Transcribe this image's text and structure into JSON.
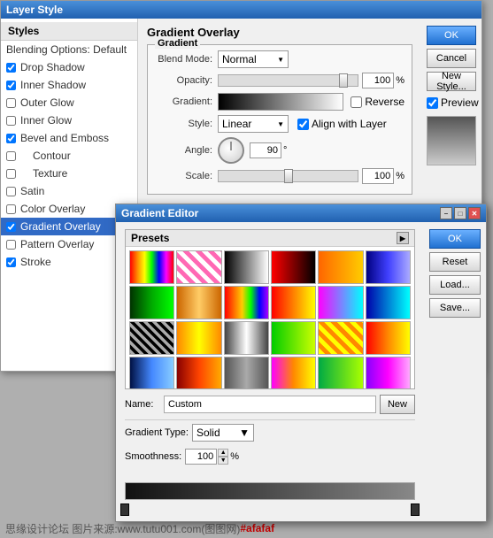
{
  "layerStyleDialog": {
    "title": "Layer Style",
    "buttons": {
      "ok": "OK",
      "cancel": "Cancel",
      "newStyle": "New Style...",
      "preview": "Preview"
    },
    "stylesPanel": {
      "header": "Styles",
      "items": [
        {
          "id": "blending-options",
          "label": "Blending Options: Default",
          "checked": false,
          "active": false
        },
        {
          "id": "drop-shadow",
          "label": "Drop Shadow",
          "checked": true,
          "active": false
        },
        {
          "id": "inner-shadow",
          "label": "Inner Shadow",
          "checked": true,
          "active": false
        },
        {
          "id": "outer-glow",
          "label": "Outer Glow",
          "checked": false,
          "active": false
        },
        {
          "id": "inner-glow",
          "label": "Inner Glow",
          "checked": false,
          "active": false
        },
        {
          "id": "bevel-emboss",
          "label": "Bevel and Emboss",
          "checked": true,
          "active": false
        },
        {
          "id": "contour",
          "label": "Contour",
          "checked": false,
          "active": false,
          "indent": true
        },
        {
          "id": "texture",
          "label": "Texture",
          "checked": false,
          "active": false,
          "indent": true
        },
        {
          "id": "satin",
          "label": "Satin",
          "checked": false,
          "active": false
        },
        {
          "id": "color-overlay",
          "label": "Color Overlay",
          "checked": false,
          "active": false
        },
        {
          "id": "gradient-overlay",
          "label": "Gradient Overlay",
          "checked": true,
          "active": true
        },
        {
          "id": "pattern-overlay",
          "label": "Pattern Overlay",
          "checked": false,
          "active": false
        },
        {
          "id": "stroke",
          "label": "Stroke",
          "checked": true,
          "active": false
        }
      ]
    },
    "gradientOverlay": {
      "sectionTitle": "Gradient Overlay",
      "groupTitle": "Gradient",
      "blendMode": {
        "label": "Blend Mode:",
        "value": "Normal"
      },
      "opacity": {
        "label": "Opacity:",
        "value": "100",
        "unit": "%",
        "sliderPos": 90
      },
      "gradient": {
        "label": "Gradient:",
        "reverse": "Reverse",
        "reverseChecked": false
      },
      "style": {
        "label": "Style:",
        "value": "Linear",
        "alignWithLayer": "Align with Layer",
        "alignChecked": true
      },
      "angle": {
        "label": "Angle:",
        "value": "90",
        "unit": "°"
      },
      "scale": {
        "label": "Scale:",
        "value": "100",
        "unit": "%",
        "sliderPos": 50
      }
    }
  },
  "gradientEditor": {
    "title": "Gradient Editor",
    "titlebarButtons": {
      "minimize": "–",
      "maximize": "□",
      "close": "✕"
    },
    "presetsSection": {
      "title": "Presets",
      "presets": [
        "p1",
        "p2",
        "p3",
        "p4",
        "p5",
        "p6",
        "p7",
        "p8",
        "p9",
        "p10",
        "p11",
        "p12",
        "p13",
        "p14",
        "p15",
        "p16",
        "p17",
        "p18",
        "p19",
        "p20",
        "p21",
        "p22",
        "p23",
        "p24"
      ]
    },
    "buttons": {
      "ok": "OK",
      "reset": "Reset",
      "load": "Load...",
      "save": "Save...",
      "new": "New"
    },
    "name": {
      "label": "Name:",
      "value": "Custom"
    },
    "gradientType": {
      "label": "Gradient Type:",
      "value": "Solid"
    },
    "smoothness": {
      "label": "Smoothness:",
      "value": "100",
      "unit": "%"
    }
  },
  "watermark": {
    "text": "思缘设计论坛 图片来源:www.tutu001.com(图图网)",
    "colorText": "#afafaf"
  }
}
